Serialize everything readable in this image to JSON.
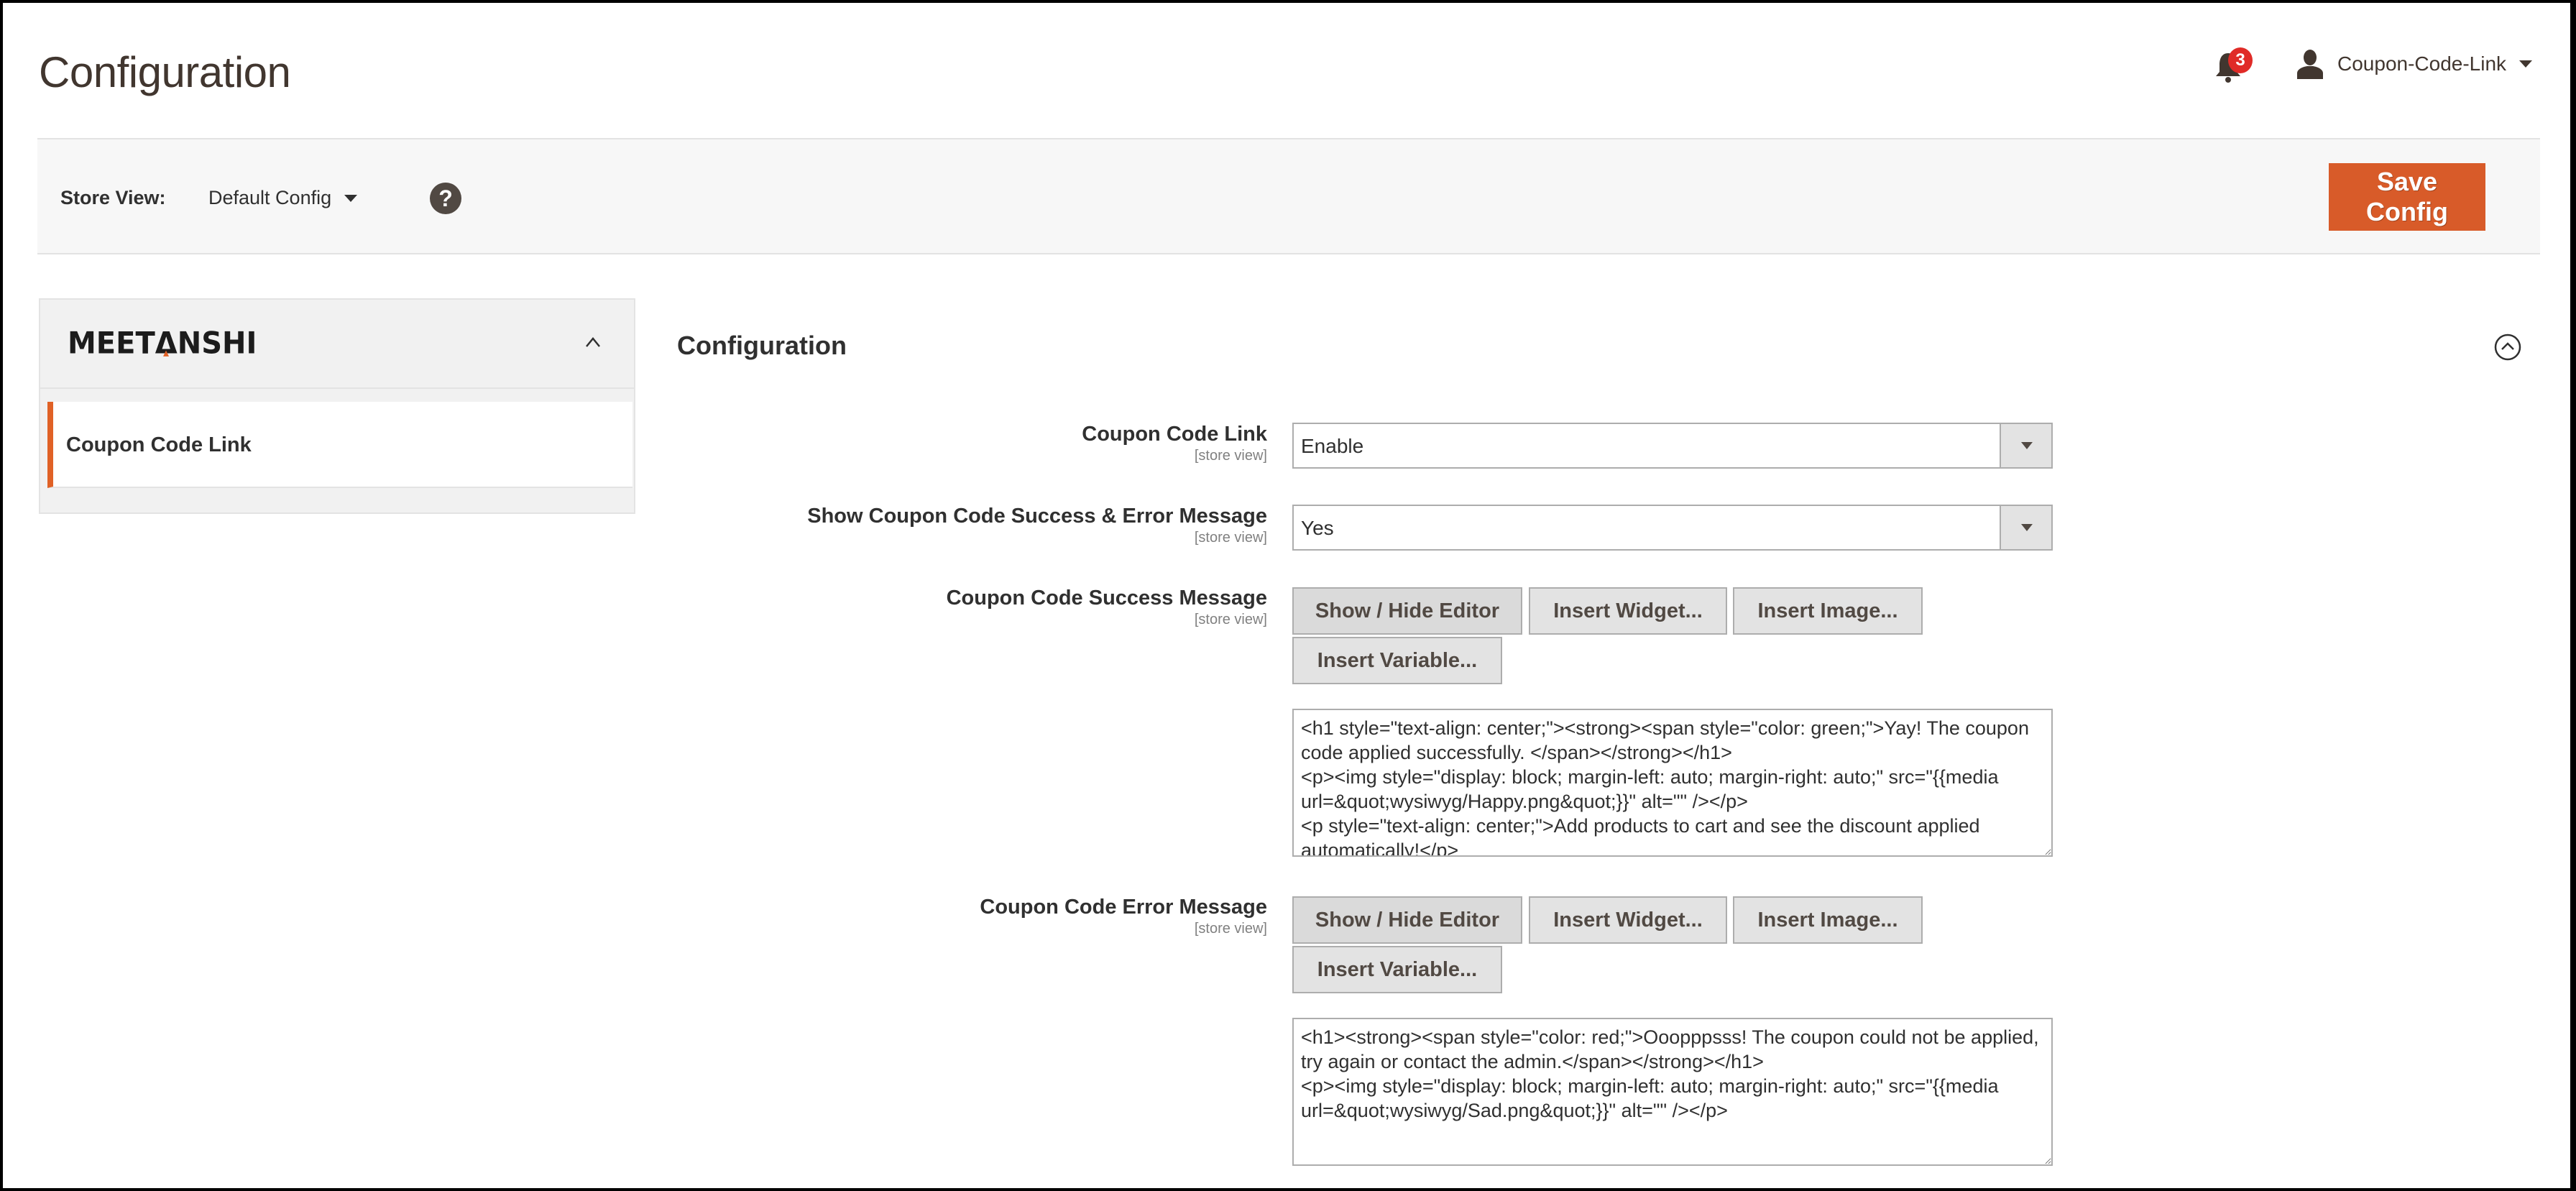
{
  "header": {
    "title": "Configuration",
    "notifications_count": "3",
    "user_name": "Coupon-Code-Link"
  },
  "store_bar": {
    "label": "Store View:",
    "selected": "Default Config",
    "help": "?",
    "save_label": "Save Config"
  },
  "sidebar": {
    "logo_pre": "MEET",
    "logo_tri": "Δ",
    "logo_post": "NSHI",
    "items": [
      {
        "label": "Coupon Code Link"
      }
    ]
  },
  "main": {
    "section_title": "Configuration",
    "fields": [
      {
        "label": "Coupon Code Link",
        "scope": "[store view]",
        "value": "Enable"
      },
      {
        "label": "Show Coupon Code Success & Error Message",
        "scope": "[store view]",
        "value": "Yes"
      },
      {
        "label": "Coupon Code Success Message",
        "scope": "[store view]",
        "value": "<h1 style=\"text-align: center;\"><strong><span style=\"color: green;\">Yay! The coupon code applied successfully. </span></strong></h1>\n<p><img style=\"display: block; margin-left: auto; margin-right: auto;\" src=\"{{media url=&quot;wysiwyg/Happy.png&quot;}}\" alt=\"\" /></p>\n<p style=\"text-align: center;\">Add products to cart and see the discount applied automatically!</p>"
      },
      {
        "label": "Coupon Code Error Message",
        "scope": "[store view]",
        "value": "<h1><strong><span style=\"color: red;\">Ooopppsss! The coupon could not be applied, try again or contact the admin.</span></strong></h1>\n<p><img style=\"display: block; margin-left: auto; margin-right: auto;\" src=\"{{media url=&quot;wysiwyg/Sad.png&quot;}}\" alt=\"\" /></p>"
      }
    ],
    "editor_buttons": {
      "show_hide": "Show / Hide Editor",
      "insert_widget": "Insert Widget...",
      "insert_image": "Insert Image...",
      "insert_variable": "Insert Variable..."
    }
  },
  "colors": {
    "accent": "#e06126",
    "save_button": "#d85b29",
    "badge": "#e02b27"
  }
}
